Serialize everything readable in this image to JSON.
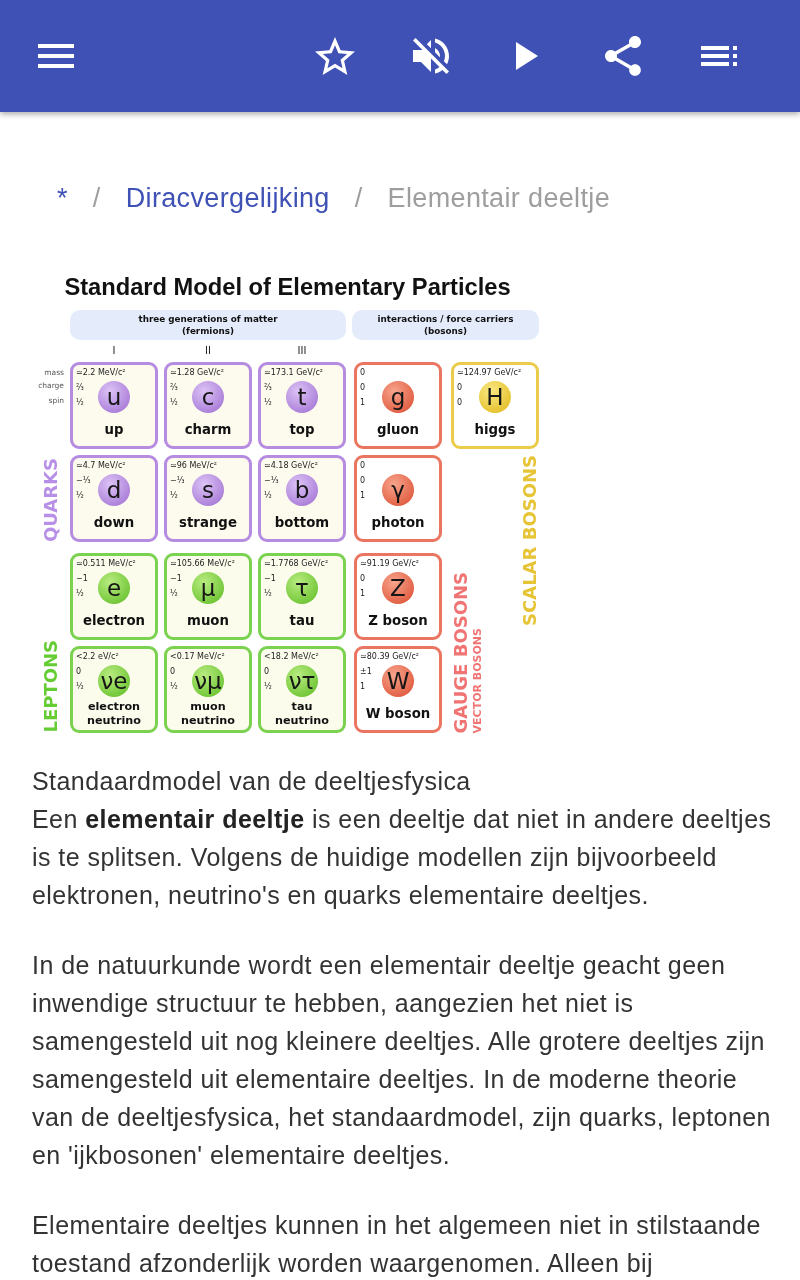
{
  "app_bar": {
    "favorite": false,
    "muted": true,
    "playing": false
  },
  "breadcrumb": [
    {
      "kind": "link",
      "text": "*"
    },
    {
      "kind": "separator",
      "text": "/"
    },
    {
      "kind": "link",
      "text": "Diracvergelijking"
    },
    {
      "kind": "separator",
      "text": "/"
    },
    {
      "kind": "current",
      "text": "Elementair deeltje"
    }
  ],
  "figure": {
    "title": "Standard Model of Elementary Particles",
    "groups": [
      {
        "label": "three generations of matter",
        "sublabel": "(fermions)"
      },
      {
        "label": "interactions / force carriers",
        "sublabel": "(bosons)"
      }
    ],
    "generations": [
      "I",
      "II",
      "III"
    ],
    "property_labels": [
      "mass",
      "charge",
      "spin"
    ],
    "rows": [
      [
        {
          "kind": "quark",
          "symbol": "u",
          "name": "up",
          "mass": "≃2.2 MeV/c²",
          "charge": "⅔",
          "spin": "½"
        },
        {
          "kind": "quark",
          "symbol": "c",
          "name": "charm",
          "mass": "≃1.28 GeV/c²",
          "charge": "⅔",
          "spin": "½"
        },
        {
          "kind": "quark",
          "symbol": "t",
          "name": "top",
          "mass": "≃173.1 GeV/c²",
          "charge": "⅔",
          "spin": "½"
        },
        {
          "kind": "gauge",
          "symbol": "g",
          "name": "gluon",
          "mass": "0",
          "charge": "0",
          "spin": "1"
        },
        {
          "kind": "scalar",
          "symbol": "H",
          "name": "higgs",
          "mass": "≃124.97 GeV/c²",
          "charge": "0",
          "spin": "0"
        }
      ],
      [
        {
          "kind": "quark",
          "symbol": "d",
          "name": "down",
          "mass": "≃4.7 MeV/c²",
          "charge": "−⅓",
          "spin": "½"
        },
        {
          "kind": "quark",
          "symbol": "s",
          "name": "strange",
          "mass": "≃96 MeV/c²",
          "charge": "−⅓",
          "spin": "½"
        },
        {
          "kind": "quark",
          "symbol": "b",
          "name": "bottom",
          "mass": "≃4.18 GeV/c²",
          "charge": "−⅓",
          "spin": "½"
        },
        {
          "kind": "gauge",
          "symbol": "γ",
          "name": "photon",
          "mass": "0",
          "charge": "0",
          "spin": "1"
        }
      ],
      [
        {
          "kind": "lepton",
          "symbol": "e",
          "name": "electron",
          "mass": "≃0.511 MeV/c²",
          "charge": "−1",
          "spin": "½"
        },
        {
          "kind": "lepton",
          "symbol": "μ",
          "name": "muon",
          "mass": "≃105.66 MeV/c²",
          "charge": "−1",
          "spin": "½"
        },
        {
          "kind": "lepton",
          "symbol": "τ",
          "name": "tau",
          "mass": "≃1.7768 GeV/c²",
          "charge": "−1",
          "spin": "½"
        },
        {
          "kind": "gauge",
          "symbol": "Z",
          "name": "Z boson",
          "mass": "≃91.19 GeV/c²",
          "charge": "0",
          "spin": "1"
        }
      ],
      [
        {
          "kind": "lepton",
          "symbol": "νe",
          "name": "electron neutrino",
          "mass": "<2.2 eV/c²",
          "charge": "0",
          "spin": "½"
        },
        {
          "kind": "lepton",
          "symbol": "νμ",
          "name": "muon neutrino",
          "mass": "<0.17 MeV/c²",
          "charge": "0",
          "spin": "½"
        },
        {
          "kind": "lepton",
          "symbol": "ντ",
          "name": "tau neutrino",
          "mass": "<18.2 MeV/c²",
          "charge": "0",
          "spin": "½"
        },
        {
          "kind": "gauge",
          "symbol": "W",
          "name": "W boson",
          "mass": "≃80.39 GeV/c²",
          "charge": "±1",
          "spin": "1"
        }
      ]
    ],
    "category_labels": [
      {
        "kind": "scalar",
        "text": "SCALAR BOSONS"
      },
      {
        "kind": "quark",
        "text": "QUARKS"
      },
      {
        "kind": "gauge",
        "text": "GAUGE BOSONS",
        "subtext": "VECTOR BOSONS"
      },
      {
        "kind": "lepton",
        "text": "LEPTONS"
      }
    ]
  },
  "caption": "Standaardmodel van de deeltjesfysica",
  "paragraphs": [
    "Een **elementair deeltje** is een deeltje dat niet in andere deeltjes is te splitsen. Volgens de huidige modellen zijn bijvoorbeeld elektronen, neutrino's en quarks elementaire deeltjes.",
    "In de natuurkunde wordt een elementair deeltje geacht geen inwendige structuur te hebben, aangezien het niet is samengesteld uit nog kleinere deeltjes. Alle grotere deeltjes zijn samengesteld uit elementaire deeltjes. In de moderne theorie van de deeltjesfysica, het standaardmodel, zijn quarks, leptonen en 'ijkbosonen' elementaire deeltjes.",
    "Elementaire deeltjes kunnen in het algemeen niet in stilstaande toestand afzonderlijk worden waargenomen. Alleen bij"
  ]
}
